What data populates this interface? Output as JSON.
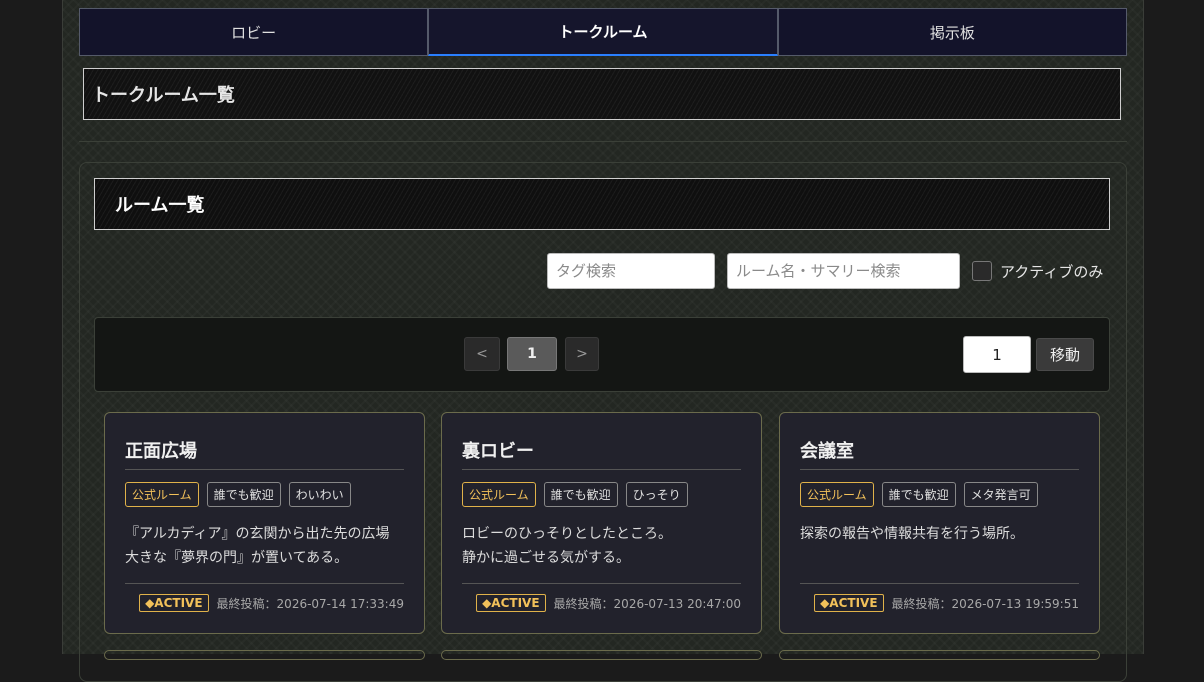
{
  "tabs": [
    {
      "label": "ロビー"
    },
    {
      "label": "トークルーム"
    },
    {
      "label": "掲示板"
    }
  ],
  "page_title": "トークルーム一覧",
  "section_title": "ルーム一覧",
  "search": {
    "tag_placeholder": "タグ検索",
    "name_placeholder": "ルーム名・サマリー検索",
    "active_only_label": "アクティブのみ"
  },
  "pager": {
    "prev": "<",
    "current": "1",
    "next": ">",
    "jump_value": "1",
    "jump_label": "移動"
  },
  "rooms": [
    {
      "title": "正面広場",
      "tags": [
        "公式ルーム",
        "誰でも歓迎",
        "わいわい"
      ],
      "summary_line1": "『アルカディア』の玄関から出た先の広場",
      "summary_line2": "大きな『夢界の門』が置いてある。",
      "badge": "◆ACTIVE",
      "last_post": "最終投稿：2026-07-14 17:33:49"
    },
    {
      "title": "裏ロビー",
      "tags": [
        "公式ルーム",
        "誰でも歓迎",
        "ひっそり"
      ],
      "summary_line1": "ロビーのひっそりとしたところ。",
      "summary_line2": "静かに過ごせる気がする。",
      "badge": "◆ACTIVE",
      "last_post": "最終投稿：2026-07-13 20:47:00"
    },
    {
      "title": "会議室",
      "tags": [
        "公式ルーム",
        "誰でも歓迎",
        "メタ発言可"
      ],
      "summary_line1": "探索の報告や情報共有を行う場所。",
      "summary_line2": "",
      "badge": "◆ACTIVE",
      "last_post": "最終投稿：2026-07-13 19:59:51"
    }
  ]
}
